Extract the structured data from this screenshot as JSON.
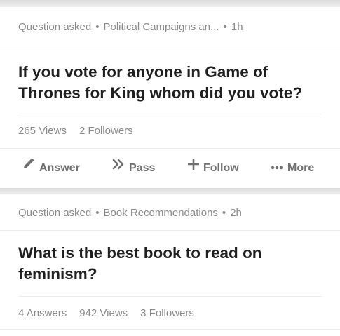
{
  "questions": [
    {
      "meta": {
        "type": "Question asked",
        "topic": "Political Campaigns an...",
        "time": "1h"
      },
      "title": "If you vote for anyone in Game of Thrones for King whom did you vote?",
      "stats": {
        "views_count": "265",
        "views_label": "Views",
        "followers_count": "2",
        "followers_label": "Followers"
      },
      "actions": {
        "answer": {
          "label": "Answer",
          "icon": "pencil-icon"
        },
        "pass": {
          "label": "Pass",
          "icon": "double-chevron-icon"
        },
        "follow": {
          "label": "Follow",
          "icon": "plus-icon"
        },
        "more": {
          "label": "More",
          "icon": "ellipsis-icon"
        }
      }
    },
    {
      "meta": {
        "type": "Question asked",
        "topic": "Book Recommendations",
        "time": "2h"
      },
      "title": "What is the best book to read on feminism?",
      "stats": {
        "answers_count": "4",
        "answers_label": "Answers",
        "views_count": "942",
        "views_label": "Views",
        "followers_count": "3",
        "followers_label": "Followers"
      }
    }
  ],
  "colors": {
    "page_background": "#e9e9e9",
    "card_background": "#ffffff",
    "title_text": "#1f1f1f",
    "muted_text": "#8a8a8a",
    "action_text": "#6f6f6f"
  }
}
